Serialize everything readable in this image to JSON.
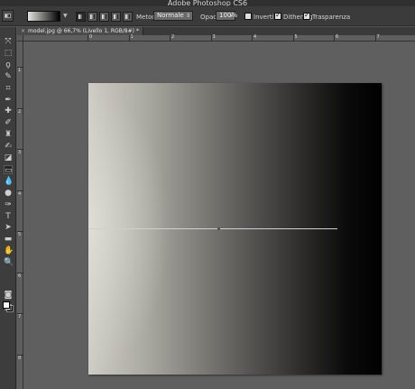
{
  "window": {
    "title": "Adobe Photoshop CS6"
  },
  "options_bar": {
    "method_label": "Metodo:",
    "method_value": "Normale",
    "opacity_label": "Opacità:",
    "opacity_value": "100%",
    "reverse_label": "Inverti",
    "dither_label": "Dithering",
    "transparency_label": "Trasparenza",
    "reverse_checked": false,
    "dither_checked": true,
    "transparency_checked": true
  },
  "document_tab": {
    "title": "model.jpg @ 66,7% (Livello 1, RGB/8#) *",
    "close_glyph": "×"
  },
  "rulers": {
    "top": [
      "0",
      "1",
      "2",
      "3",
      "4",
      "5",
      "6",
      "7",
      "8"
    ],
    "left": [
      "1",
      "2",
      "3",
      "4",
      "5",
      "6",
      "7",
      "8"
    ]
  },
  "tools": [
    {
      "name": "move-tool-icon",
      "glyph": "⤧"
    },
    {
      "name": "marquee-tool-icon",
      "glyph": "⬚"
    },
    {
      "name": "lasso-tool-icon",
      "glyph": "ϙ"
    },
    {
      "name": "quick-selection-tool-icon",
      "glyph": "✎"
    },
    {
      "name": "crop-tool-icon",
      "glyph": "⌗"
    },
    {
      "name": "eyedropper-tool-icon",
      "glyph": "✒"
    },
    {
      "name": "healing-brush-tool-icon",
      "glyph": "✚"
    },
    {
      "name": "brush-tool-icon",
      "glyph": "✐"
    },
    {
      "name": "clone-stamp-tool-icon",
      "glyph": "♜"
    },
    {
      "name": "history-brush-tool-icon",
      "glyph": "✍"
    },
    {
      "name": "eraser-tool-icon",
      "glyph": "◪"
    },
    {
      "name": "gradient-tool-icon",
      "glyph": "▭"
    },
    {
      "name": "blur-tool-icon",
      "glyph": "💧"
    },
    {
      "name": "dodge-tool-icon",
      "glyph": "●"
    },
    {
      "name": "pen-tool-icon",
      "glyph": "✑"
    },
    {
      "name": "type-tool-icon",
      "glyph": "T"
    },
    {
      "name": "path-selection-tool-icon",
      "glyph": "➤"
    },
    {
      "name": "shape-tool-icon",
      "glyph": "▬"
    },
    {
      "name": "hand-tool-icon",
      "glyph": "✋"
    },
    {
      "name": "zoom-tool-icon",
      "glyph": "🔍"
    }
  ],
  "extra_tools": [
    {
      "name": "quick-mask-icon",
      "glyph": "◙"
    },
    {
      "name": "screen-mode-icon",
      "glyph": "▣"
    }
  ],
  "selected_tool": "gradient-tool-icon",
  "colors": {
    "foreground": "#ffffff",
    "background": "#000000"
  }
}
